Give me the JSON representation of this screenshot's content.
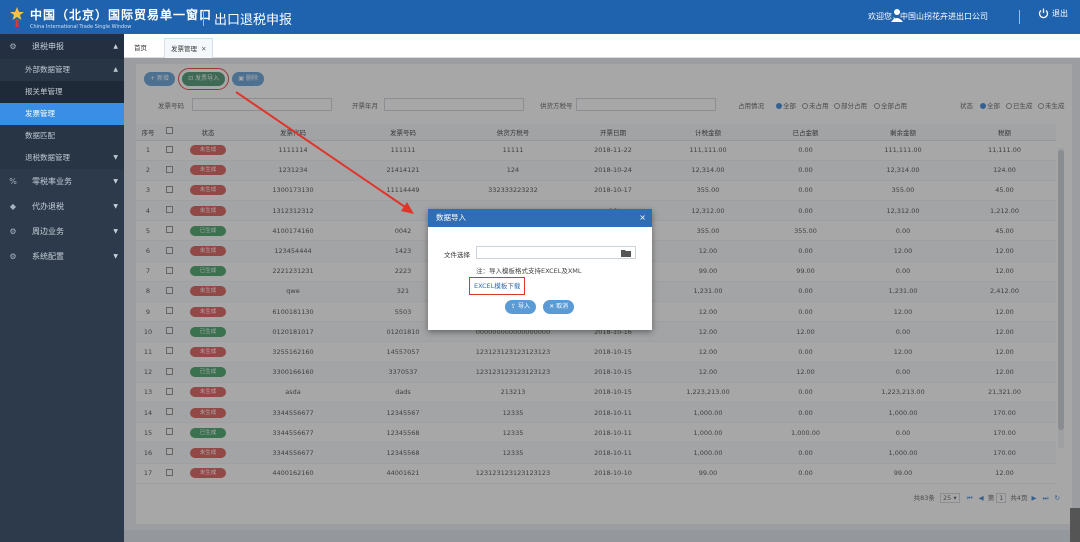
{
  "header": {
    "title": "中国（北京）国际贸易单一窗口",
    "subtitle_en": "China International Trade Single Window",
    "system": "出口退税申报",
    "welcome": "欢迎您，中国山拐花卉进出口公司",
    "logout": "退出"
  },
  "sidebar": {
    "items": [
      {
        "label": "退税申报",
        "icon": "gear-icon"
      },
      {
        "label": "外部数据管理"
      },
      {
        "label": "报关单管理"
      },
      {
        "label": "发票管理"
      },
      {
        "label": "数据匹配"
      },
      {
        "label": "退税数据管理"
      },
      {
        "label": "零税率业务",
        "icon": "percent-icon"
      },
      {
        "label": "代办退税",
        "icon": "layers-icon"
      },
      {
        "label": "周边业务",
        "icon": "gear-icon"
      },
      {
        "label": "系统配置",
        "icon": "gear-icon"
      }
    ]
  },
  "tabs": {
    "home": "首页",
    "current": "发票管理",
    "close": "✕"
  },
  "toolbar": {
    "add": "新增",
    "import": "发票导入",
    "delete": "删除"
  },
  "filters": {
    "invoice_no": "发票号码",
    "date": "开票年月",
    "supplier": "供货方税号",
    "usage": "占用情况",
    "usage_options": [
      "全部",
      "未占用",
      "部分占用",
      "全部占用"
    ],
    "status": "状态",
    "status_options": [
      "全部",
      "已生成",
      "未生成"
    ]
  },
  "table": {
    "headers": [
      "序号",
      "",
      "状态",
      "发票代码",
      "发票号码",
      "供货方税号",
      "开票日期",
      "计税金额",
      "已占金额",
      "剩余金额",
      "税额"
    ],
    "rows": [
      {
        "n": "1",
        "st": "未生成",
        "code": "1111114",
        "no": "111111",
        "sup": "11111",
        "date": "2018-11-22",
        "amt": "111,111.00",
        "used": "0.00",
        "rest": "111,111.00",
        "tax": "11,111.00"
      },
      {
        "n": "2",
        "st": "未生成",
        "code": "1231234",
        "no": "21414121",
        "sup": "124",
        "date": "2018-10-24",
        "amt": "12,314.00",
        "used": "0.00",
        "rest": "12,314.00",
        "tax": "124.00"
      },
      {
        "n": "3",
        "st": "未生成",
        "code": "1300173130",
        "no": "11114449",
        "sup": "332333223232",
        "date": "2018-10-17",
        "amt": "355.00",
        "used": "0.00",
        "rest": "355.00",
        "tax": "45.00"
      },
      {
        "n": "4",
        "st": "未生成",
        "code": "1312312312",
        "no": "",
        "sup": "",
        "date": "16",
        "amt": "12,312.00",
        "used": "0.00",
        "rest": "12,312.00",
        "tax": "1,212.00"
      },
      {
        "n": "5",
        "st": "已生成",
        "code": "4100174160",
        "no": "0042",
        "sup": "",
        "date": "16",
        "amt": "355.00",
        "used": "355.00",
        "rest": "0.00",
        "tax": "45.00"
      },
      {
        "n": "6",
        "st": "未生成",
        "code": "123454444",
        "no": "1423",
        "sup": "",
        "date": "16",
        "amt": "12.00",
        "used": "0.00",
        "rest": "12.00",
        "tax": "12.00"
      },
      {
        "n": "7",
        "st": "已生成",
        "code": "2221231231",
        "no": "2223",
        "sup": "",
        "date": "16",
        "amt": "99.00",
        "used": "99.00",
        "rest": "0.00",
        "tax": "12.00"
      },
      {
        "n": "8",
        "st": "未生成",
        "code": "qwe",
        "no": "321",
        "sup": "",
        "date": "16",
        "amt": "1,231.00",
        "used": "0.00",
        "rest": "1,231.00",
        "tax": "2,412.00"
      },
      {
        "n": "9",
        "st": "未生成",
        "code": "6100181130",
        "no": "5503",
        "sup": "",
        "date": "16",
        "amt": "12.00",
        "used": "0.00",
        "rest": "12.00",
        "tax": "12.00"
      },
      {
        "n": "10",
        "st": "已生成",
        "code": "0120181017",
        "no": "01201810",
        "sup": "000000000000000000",
        "date": "2018-10-16",
        "amt": "12.00",
        "used": "12.00",
        "rest": "0.00",
        "tax": "12.00"
      },
      {
        "n": "11",
        "st": "未生成",
        "code": "3255162160",
        "no": "14557057",
        "sup": "123123123123123123",
        "date": "2018-10-15",
        "amt": "12.00",
        "used": "0.00",
        "rest": "12.00",
        "tax": "12.00"
      },
      {
        "n": "12",
        "st": "已生成",
        "code": "3300166160",
        "no": "3370537",
        "sup": "123123123123123123",
        "date": "2018-10-15",
        "amt": "12.00",
        "used": "12.00",
        "rest": "0.00",
        "tax": "12.00"
      },
      {
        "n": "13",
        "st": "未生成",
        "code": "asda",
        "no": "dads",
        "sup": "213213",
        "date": "2018-10-15",
        "amt": "1,223,213.00",
        "used": "0.00",
        "rest": "1,223,213.00",
        "tax": "21,321.00"
      },
      {
        "n": "14",
        "st": "未生成",
        "code": "3344556677",
        "no": "12345567",
        "sup": "12335",
        "date": "2018-10-11",
        "amt": "1,000.00",
        "used": "0.00",
        "rest": "1,000.00",
        "tax": "170.00"
      },
      {
        "n": "15",
        "st": "已生成",
        "code": "3344556677",
        "no": "12345568",
        "sup": "12335",
        "date": "2018-10-11",
        "amt": "1,000.00",
        "used": "1,000.00",
        "rest": "0.00",
        "tax": "170.00"
      },
      {
        "n": "16",
        "st": "未生成",
        "code": "3344556677",
        "no": "12345568",
        "sup": "12335",
        "date": "2018-10-11",
        "amt": "1,000.00",
        "used": "0.00",
        "rest": "1,000.00",
        "tax": "170.00"
      },
      {
        "n": "17",
        "st": "未生成",
        "code": "4400162160",
        "no": "44001621",
        "sup": "123123123123123123",
        "date": "2018-10-10",
        "amt": "99.00",
        "used": "0.00",
        "rest": "99.00",
        "tax": "12.00"
      }
    ]
  },
  "pager": {
    "total": "共83条",
    "size": "25",
    "page": "1",
    "pages": "共4页"
  },
  "dialog": {
    "title": "数据导入",
    "file_label": "文件选择",
    "note": "注：导入模板格式支持EXCEL及XML",
    "download": "EXCEL模板下载",
    "import": "导入",
    "cancel": "取消",
    "close": "×"
  },
  "colors": {
    "header": "#1f62ad",
    "sidebar": "#2d3a4b",
    "active": "#3a8ee6",
    "annotation": "#e0352b",
    "not_generated": "#d9534f",
    "generated": "#3a9d5d"
  }
}
